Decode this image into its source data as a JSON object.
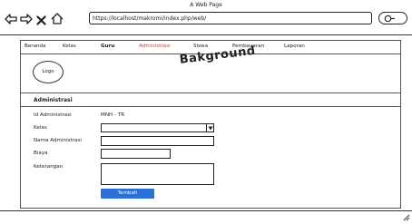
{
  "window": {
    "title": "A Web Page"
  },
  "toolbar": {
    "url": "https://localhost/makromi/index.php/web/"
  },
  "menu": {
    "items": [
      {
        "label": "Beranda",
        "active": false
      },
      {
        "label": "Kelas",
        "active": false
      },
      {
        "label": "Guru",
        "active": false
      },
      {
        "label": "Administrasi",
        "active": true
      },
      {
        "label": "Siswa",
        "active": false
      },
      {
        "label": "Pembayaran",
        "active": false
      },
      {
        "label": "Laporan",
        "active": false
      }
    ],
    "active_color": "#d63b3b"
  },
  "header": {
    "logo_label": "Logo",
    "banner": "Bakground"
  },
  "form": {
    "title": "Administrasi",
    "id_label": "Id Administrasi",
    "id_value": "MNH - TR",
    "kelas_label": "Kelas",
    "kelas_value": "",
    "nama_label": "Nama Administrasi",
    "nama_value": "",
    "biaya_label": "Biaya",
    "biaya_value": "",
    "keterangan_label": "Keterangan",
    "keterangan_value": "",
    "submit_label": "Tambah",
    "submit_color": "#2a6fd6"
  }
}
